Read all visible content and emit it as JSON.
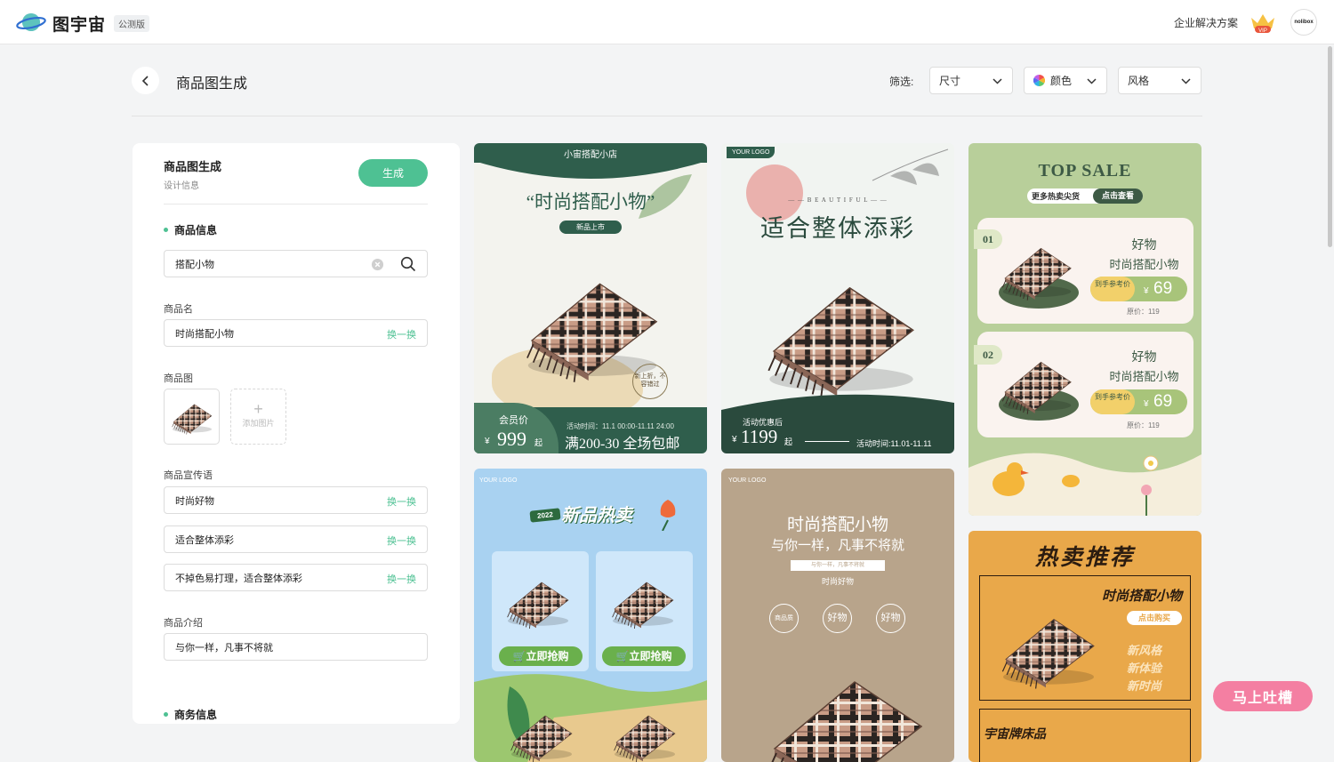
{
  "app": {
    "name": "图宇宙",
    "badge": "公测版",
    "enterprise": "企业解决方案",
    "vip": "VIP",
    "avatar_text": "nolibox"
  },
  "header": {
    "title": "商品图生成",
    "filter_label": "筛选:",
    "filters": [
      {
        "label": "尺寸"
      },
      {
        "label": "颜色"
      },
      {
        "label": "风格"
      }
    ]
  },
  "panel": {
    "title": "商品图生成",
    "subtitle": "设计信息",
    "generate": "生成",
    "product_info": "商品信息",
    "search_value": "搭配小物",
    "name_label": "商品名",
    "name_value": "时尚搭配小物",
    "swap": "换一换",
    "image_label": "商品图",
    "add_image": "添加图片",
    "slogan_label": "商品宣传语",
    "slogans": [
      "时尚好物",
      "适合整体添彩",
      "不掉色易打理，适合整体添彩"
    ],
    "intro_label": "商品介绍",
    "intro_value": "与你一样，凡事不将就",
    "business": "商务信息"
  },
  "cards": {
    "c1": {
      "shop": "小宙搭配小店",
      "title": "“时尚搭配小物”",
      "tag": "新品上市",
      "seal": "新上折，不容错过",
      "member": "会员价",
      "price": "999",
      "unit": "起",
      "time": "活动时间：11.1 00:00-11.11 24:00",
      "promo": "满200-30 全场包邮",
      "currency": "¥"
    },
    "c2": {
      "logo": "YOUR LOGO",
      "beautiful": "— — B E A U T I F U L — —",
      "title": "适合整体添彩",
      "after": "活动优惠后",
      "price": "1199",
      "unit": "起",
      "time": "活动时间:11.01-11.11",
      "currency": "¥"
    },
    "c3": {
      "title": "TOP SALE",
      "more": "更多热卖尖货",
      "click": "点击查看",
      "items": [
        {
          "no": "01",
          "l1": "好物",
          "l2": "时尚搭配小物",
          "ref": "到手参考价",
          "price": "69",
          "orig": "原价：119"
        },
        {
          "no": "02",
          "l1": "好物",
          "l2": "时尚搭配小物",
          "ref": "到手参考价",
          "price": "69",
          "orig": "原价：119"
        }
      ],
      "currency": "¥"
    },
    "c4": {
      "logo": "YOUR LOGO",
      "year": "2022",
      "title": "新品热卖",
      "buy": "立即抢购"
    },
    "c5": {
      "logo": "YOUR LOGO",
      "title": "时尚搭配小物",
      "sub": "与你一样，凡事不将就",
      "tiny": "与你一样，凡事不将就",
      "small": "时尚好物",
      "circles": [
        "商品质",
        "好物",
        "好物"
      ]
    },
    "c6": {
      "title": "热卖推荐",
      "name": "时尚搭配小物",
      "buy": "点击购买",
      "lines": [
        "新风格",
        "新体验",
        "新时尚"
      ],
      "brand": "宇宙牌床品"
    }
  },
  "feedback": "马上吐槽"
}
